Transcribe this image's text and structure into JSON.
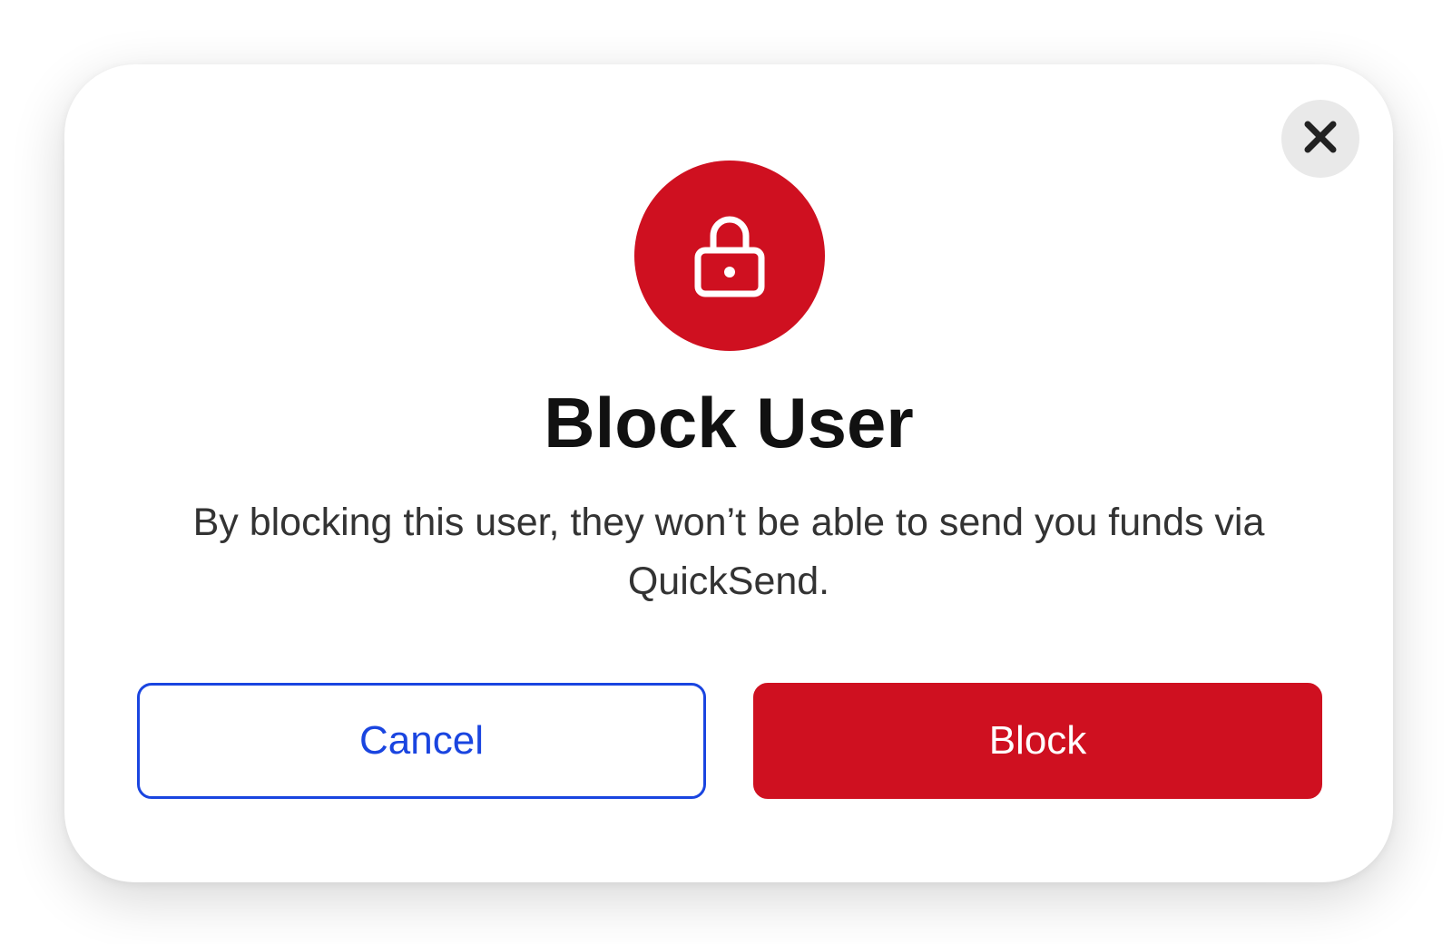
{
  "dialog": {
    "title": "Block User",
    "message": "By blocking this user, they won’t be able to send you funds via QuickSend.",
    "close_icon": "close-icon",
    "hero_icon": "lock-icon",
    "buttons": {
      "cancel_label": "Cancel",
      "block_label": "Block"
    }
  },
  "colors": {
    "danger": "#cf1020",
    "primary_outline": "#1a45e0",
    "close_bg": "#e9e9e9",
    "text_dark": "#111111",
    "text_body": "#333333"
  }
}
